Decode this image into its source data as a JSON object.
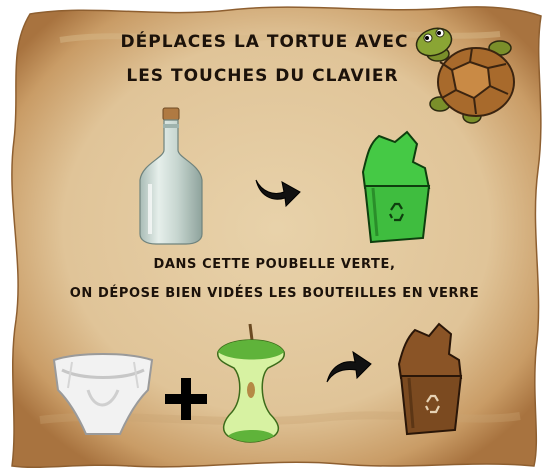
{
  "instructions": {
    "line1": "DÉPLACES LA TORTUE AVEC",
    "line2": "LES TOUCHES DU CLAVIER"
  },
  "caption": {
    "line1": "DANS CETTE POUBELLE VERTE,",
    "line2": "ON DÉPOSE BIEN VIDÉES LES BOUTEILLES EN VERRE"
  },
  "colors": {
    "parchment": "#e2c9a0",
    "parchment_edge": "#b98a55",
    "green_bin": "#3fc23f",
    "brown_bin": "#8a5426",
    "text": "#1c120a"
  },
  "icons": [
    "turtle-icon",
    "glass-bottle-icon",
    "arrow-icon",
    "green-recycle-bin-icon",
    "diaper-icon",
    "plus-icon",
    "apple-core-icon",
    "brown-recycle-bin-icon",
    "recycle-symbol-icon"
  ]
}
